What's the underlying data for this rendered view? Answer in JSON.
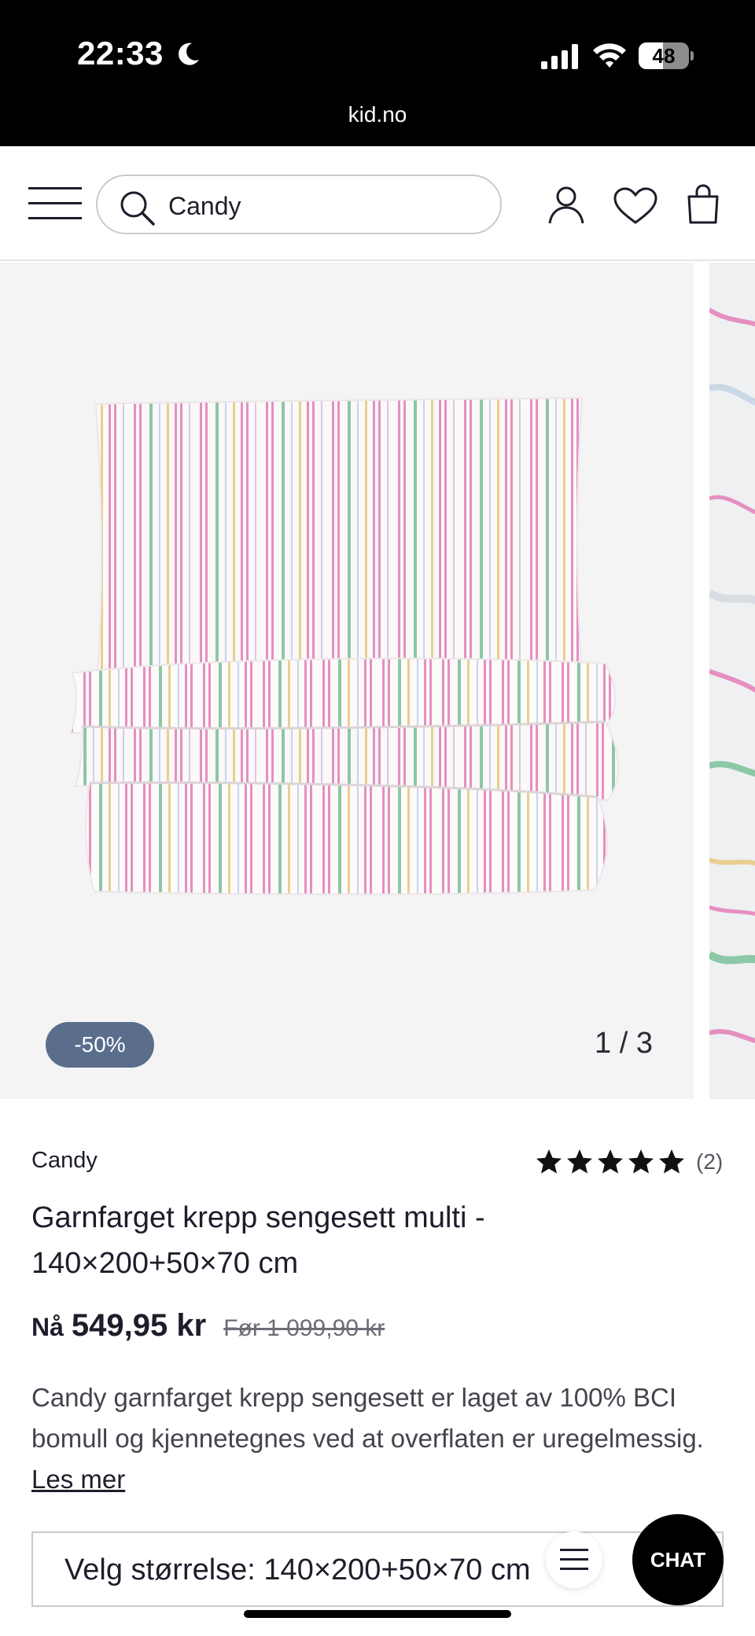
{
  "status_bar": {
    "time": "22:33",
    "battery_level": "48",
    "battery_fraction": 0.48,
    "url": "kid.no"
  },
  "header": {
    "search_value": "Candy",
    "icons": [
      "menu-icon",
      "search-icon",
      "account-icon",
      "heart-icon",
      "bag-icon"
    ]
  },
  "gallery": {
    "discount": "-50%",
    "counter": "1 / 3"
  },
  "product": {
    "brand": "Candy",
    "rating_stars": 5,
    "review_count": "(2)",
    "title": "Garnfarget krepp sengesett multi - 140×200+50×70 cm",
    "price_now_label": "Nå",
    "price_now": "549,95 kr",
    "price_before": "Før 1 099,90 kr",
    "description": "Candy garnfarget krepp sengesett er laget av 100% BCI bomull og kjennetegnes ved at overflaten er uregelmessig.",
    "read_more": "Les mer"
  },
  "size_select": {
    "label": "Velg størrelse: 140×200+50×70 cm"
  },
  "chat": {
    "label": "CHAT"
  },
  "colors": {
    "badge": "#5a6e8c",
    "text": "#1d1d2b",
    "star": "#111111",
    "stripe_pink": "#e58fc0",
    "stripe_green": "#8cc7a6",
    "stripe_yellow": "#e8cf8f"
  }
}
